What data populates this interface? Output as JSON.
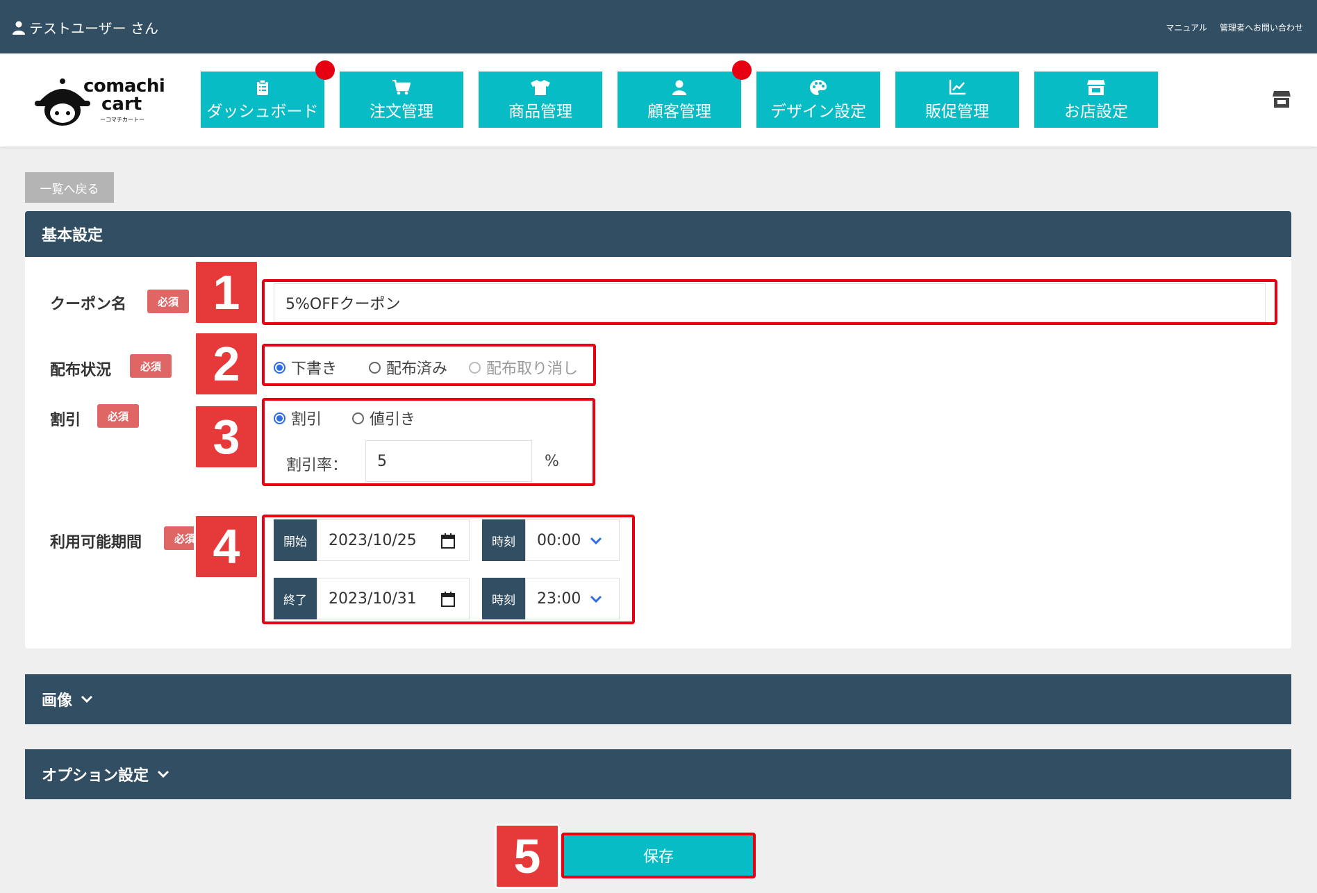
{
  "topbar": {
    "user_name": "テストユーザー さん",
    "manual": "マニュアル",
    "contact": "管理者へお問い合わせ"
  },
  "logo": {
    "line1": "comachi",
    "line2": "cart",
    "sub": "ーコマチカートー"
  },
  "nav": [
    {
      "label": "ダッシュボード",
      "icon": "clipboard-icon",
      "badge": true
    },
    {
      "label": "注文管理",
      "icon": "cart-icon",
      "badge": false
    },
    {
      "label": "商品管理",
      "icon": "shirt-icon",
      "badge": false
    },
    {
      "label": "顧客管理",
      "icon": "user-icon",
      "badge": true
    },
    {
      "label": "デザイン設定",
      "icon": "palette-icon",
      "badge": false
    },
    {
      "label": "販促管理",
      "icon": "chart-icon",
      "badge": false
    },
    {
      "label": "お店設定",
      "icon": "store-icon",
      "badge": false
    }
  ],
  "back_button": "一覧へ戻る",
  "basic": {
    "title": "基本設定",
    "required": "必須",
    "coupon_name": {
      "label": "クーポン名",
      "value": "5%OFFクーポン"
    },
    "status": {
      "label": "配布状況",
      "options": [
        "下書き",
        "配布済み",
        "配布取り消し"
      ],
      "selected": "下書き"
    },
    "discount": {
      "label": "割引",
      "options": [
        "割引",
        "値引き"
      ],
      "selected": "割引",
      "rate_label": "割引率：",
      "rate_value": "5",
      "unit": "%"
    },
    "period": {
      "label": "利用可能期間",
      "start_label": "開始",
      "start_date": "2023/10/25",
      "start_time_label": "時刻",
      "start_time": "00:00",
      "end_label": "終了",
      "end_date": "2023/10/31",
      "end_time_label": "時刻",
      "end_time": "23:00"
    }
  },
  "markers": [
    "1",
    "2",
    "3",
    "4",
    "5"
  ],
  "image_section": "画像",
  "option_section": "オプション設定",
  "save_button": "保存",
  "colors": {
    "accent": "#07bcc5",
    "dark": "#324e62",
    "marker": "#e60012",
    "required": "#e06666"
  }
}
